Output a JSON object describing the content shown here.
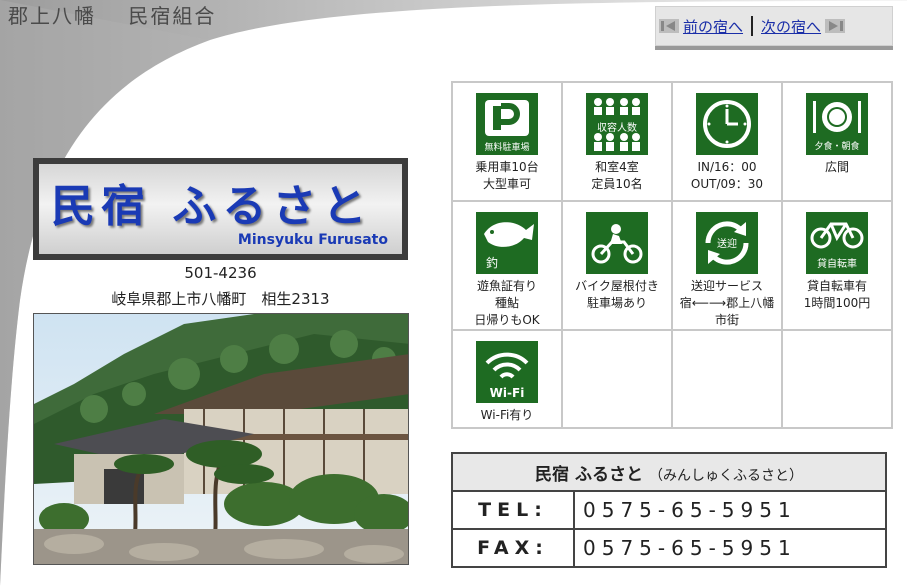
{
  "header": {
    "title_left": "郡上八幡",
    "title_right": "民宿組合",
    "prev_link": "前の宿へ",
    "next_link": "次の宿へ"
  },
  "logo": {
    "name_jp": "民宿 ふるさと",
    "name_en": "Minsyuku Furusato"
  },
  "address": {
    "postal": "501-4236",
    "line": "岐阜県郡上市八幡町　相生2313"
  },
  "amenities": [
    {
      "icon": "parking-icon",
      "icon_text": "無料駐車場",
      "lines": [
        "乗用車10台",
        "大型車可"
      ]
    },
    {
      "icon": "capacity-icon",
      "icon_text": "収容人数",
      "lines": [
        "和室4室",
        "定員10名"
      ]
    },
    {
      "icon": "clock-icon",
      "icon_text": "",
      "lines": [
        "IN/16：00",
        "OUT/09：30"
      ]
    },
    {
      "icon": "meal-icon",
      "icon_text": "夕食・朝食",
      "lines": [
        "広間"
      ]
    },
    {
      "icon": "fishing-icon",
      "icon_text": "釣",
      "lines": [
        "遊魚証有り",
        "種鮎",
        "日帰りもOK"
      ]
    },
    {
      "icon": "motorbike-icon",
      "icon_text": "",
      "lines": [
        "バイク屋根付き",
        "駐車場あり"
      ]
    },
    {
      "icon": "shuttle-icon",
      "icon_text": "送迎",
      "lines": [
        "送迎サービス",
        "宿⟵⟶郡上八幡",
        "市街"
      ]
    },
    {
      "icon": "bicycle-icon",
      "icon_text": "貸自転車",
      "lines": [
        "貸自転車有",
        "1時間100円"
      ]
    },
    {
      "icon": "wifi-icon",
      "icon_text": "Wi-Fi",
      "lines": [
        "Wi-Fi有り"
      ]
    }
  ],
  "contact": {
    "name": "民宿 ふるさと",
    "reading": "（みんしゅくふるさと）",
    "tel_label": "TEL:",
    "tel": "0575-65-5951",
    "fax_label": "FAX:",
    "fax": "0575-65-5951"
  },
  "colors": {
    "icon_green": "#1e6b22",
    "link_blue": "#1a2ea8",
    "logo_blue": "#1a3ab5"
  }
}
